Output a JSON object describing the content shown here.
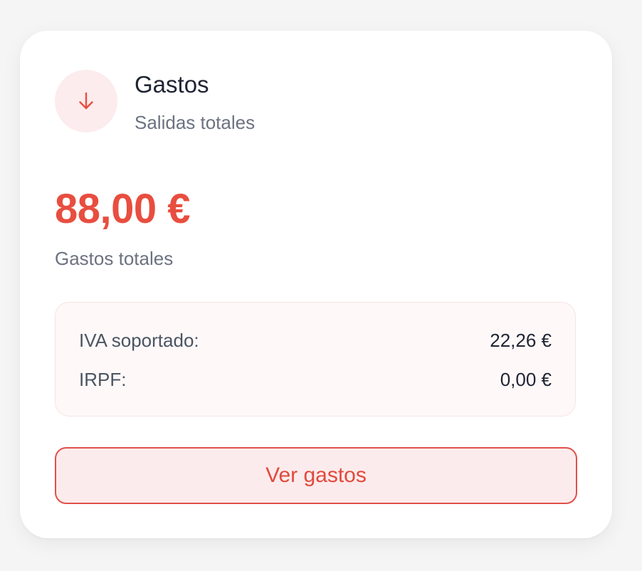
{
  "card": {
    "icon": "arrow-down-icon",
    "title": "Gastos",
    "subtitle": "Salidas totales",
    "amount": "88,00 €",
    "amount_label": "Gastos totales",
    "details": [
      {
        "label": "IVA soportado:",
        "value": "22,26 €"
      },
      {
        "label": "IRPF:",
        "value": "0,00 €"
      }
    ],
    "button_label": "Ver gastos"
  },
  "colors": {
    "accent": "#e84e3f",
    "icon_bg": "#fceced",
    "details_bg": "#fef8f8",
    "button_bg": "#fcebec",
    "text_dark": "#1f2433",
    "text_muted": "#6b7280"
  }
}
